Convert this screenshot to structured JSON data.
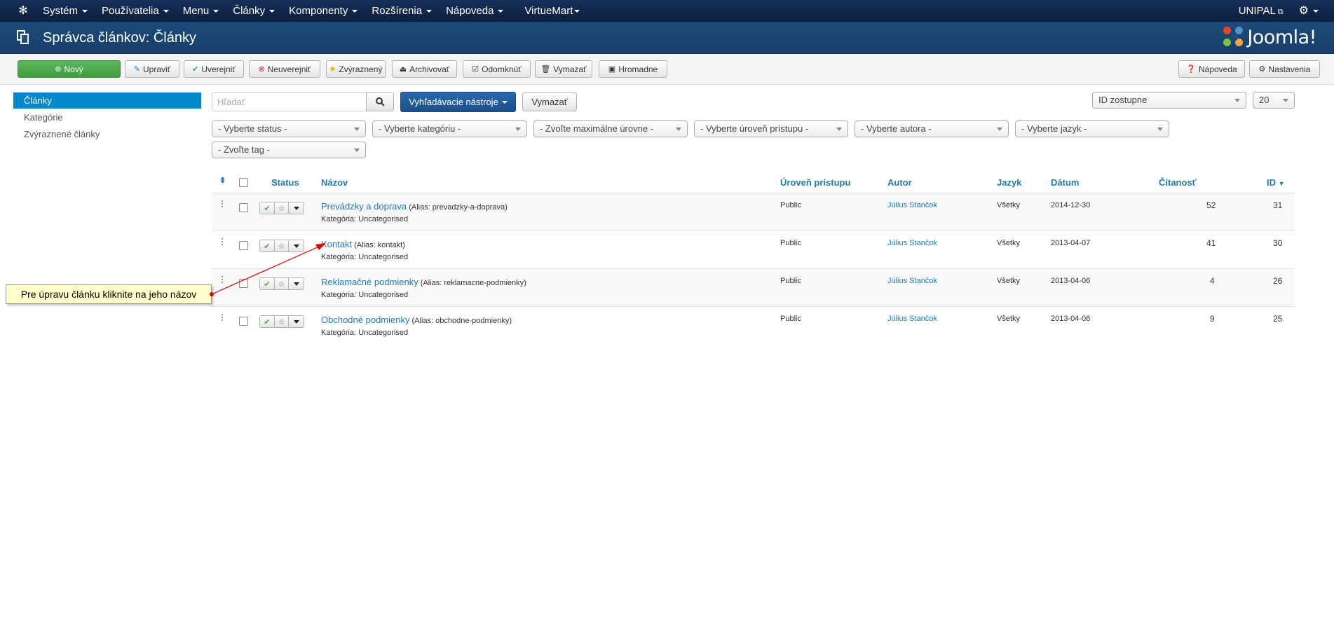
{
  "navbar": {
    "menu": [
      "Systém",
      "Používatelia",
      "Menu",
      "Články",
      "Komponenty",
      "Rozšírenia",
      "Nápoveda",
      "VirtueMart"
    ],
    "site_name": "UNIPAL"
  },
  "header": {
    "title": "Správca článkov: Články",
    "brand": "Joomla!"
  },
  "toolbar": {
    "new": "Nový",
    "edit": "Upraviť",
    "publish": "Uverejniť",
    "unpublish": "Neuverejniť",
    "feature": "Zvýraznený",
    "archive": "Archivovať",
    "checkin": "Odomknúť",
    "trash": "Vymazať",
    "batch": "Hromadne",
    "help": "Nápoveda",
    "options": "Nastavenia"
  },
  "sidebar": {
    "items": [
      "Články",
      "Kategórie",
      "Zvýraznené články"
    ]
  },
  "filters": {
    "search_placeholder": "Hľadať",
    "search_tools": "Vyhľadávacie nástroje",
    "clear": "Vymazať",
    "ordering": "ID zostupne",
    "limit": "20",
    "status": "- Vyberte status -",
    "category": "- Vyberte kategóriu -",
    "max_levels": "- Zvoľte maximálne úrovne -",
    "access": "- Vyberte úroveň prístupu -",
    "author": "- Vyberte autora -",
    "language": "- Vyberte jazyk -",
    "tag": "- Zvoľte tag -"
  },
  "table": {
    "headers": {
      "status": "Status",
      "title": "Názov",
      "access": "Úroveň prístupu",
      "author": "Autor",
      "language": "Jazyk",
      "date": "Dátum",
      "hits": "Čítanosť",
      "id": "ID"
    },
    "rows": [
      {
        "title": "Prevádzky a doprava",
        "alias": "(Alias: prevadzky-a-doprava)",
        "category": "Kategória: Uncategorised",
        "access": "Public",
        "author": "Július Stančok",
        "language": "Všetky",
        "date": "2014-12-30",
        "hits": "52",
        "id": "31"
      },
      {
        "title": "Kontakt",
        "alias": "(Alias: kontakt)",
        "category": "Kategória: Uncategorised",
        "access": "Public",
        "author": "Július Stančok",
        "language": "Všetky",
        "date": "2013-04-07",
        "hits": "41",
        "id": "30"
      },
      {
        "title": "Reklamačné podmienky",
        "alias": "(Alias: reklamacne-podmienky)",
        "category": "Kategória: Uncategorised",
        "access": "Public",
        "author": "Július Stančok",
        "language": "Všetky",
        "date": "2013-04-06",
        "hits": "4",
        "id": "26"
      },
      {
        "title": "Obchodné podmienky",
        "alias": "(Alias: obchodne-podmienky)",
        "category": "Kategória: Uncategorised",
        "access": "Public",
        "author": "Július Stančok",
        "language": "Všetky",
        "date": "2013-04-06",
        "hits": "9",
        "id": "25"
      }
    ]
  },
  "callout": {
    "text": "Pre úpravu článku kliknite na jeho názov"
  },
  "colors": {
    "navbar": "#16305a",
    "header": "#1d4b7a",
    "primary": "#5cb85c",
    "link": "#1f7ab4",
    "active": "#0088cc",
    "callout_bg": "#ffffcc",
    "arrow": "#e00000"
  }
}
